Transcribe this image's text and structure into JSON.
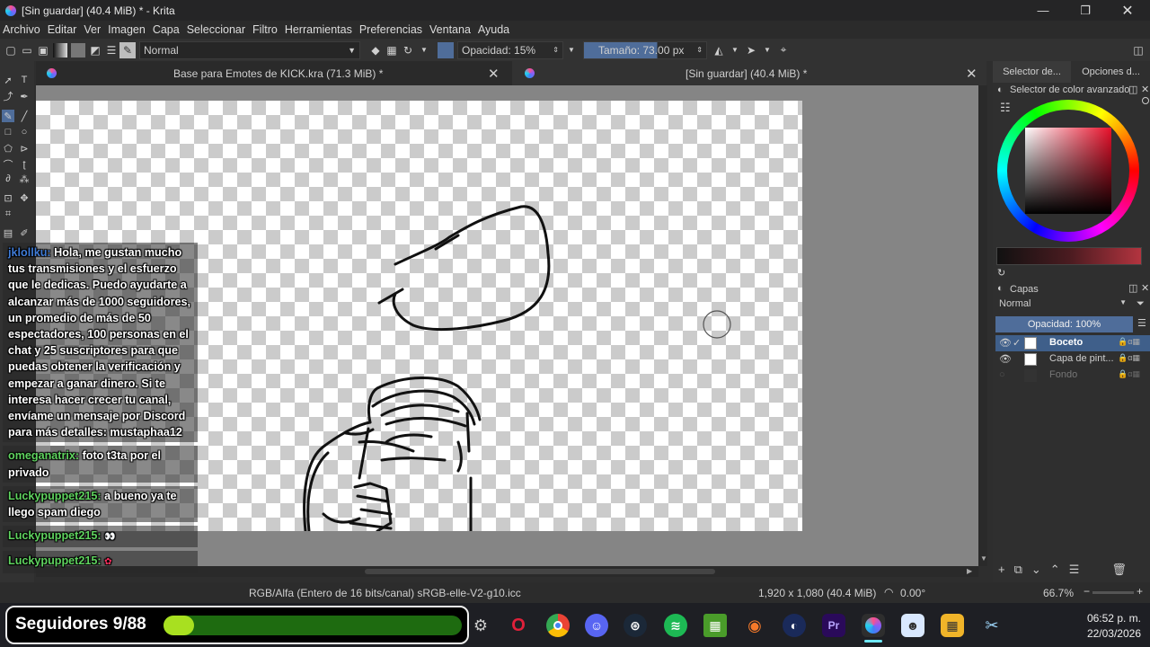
{
  "titlebar": {
    "title": "[Sin guardar]  (40.4 MiB) * - Krita"
  },
  "menu": [
    "Archivo",
    "Editar",
    "Ver",
    "Imagen",
    "Capa",
    "Seleccionar",
    "Filtro",
    "Herramientas",
    "Preferencias",
    "Ventana",
    "Ayuda"
  ],
  "toolbar": {
    "blend_mode": "Normal",
    "opacity": "Opacidad: 15%",
    "size": "Tamaño: 73.00 px"
  },
  "tabs": [
    {
      "label": "Base para Emotes de KICK.kra (71.3 MiB) *"
    },
    {
      "label": "[Sin guardar]  (40.4 MiB) *"
    }
  ],
  "docker": {
    "tab1": "Selector de...",
    "tab2": "Opciones d...",
    "color_title": "Selector de color avanzado",
    "layers_title": "Capas",
    "blend_mode": "Normal",
    "opacity": "Opacidad:  100%",
    "layers": [
      {
        "name": "Boceto",
        "active": true
      },
      {
        "name": "Capa de pint...",
        "active": false
      },
      {
        "name": "Fondo",
        "active": false
      }
    ]
  },
  "status": {
    "color_profile": "RGB/Alfa (Entero de 16 bits/canal)  sRGB-elle-V2-g10.icc",
    "dimensions": "1,920 x 1,080 (40.4 MiB)",
    "rotation": "0.00°",
    "zoom": "66.7%"
  },
  "chat": [
    {
      "user": "jklollku:",
      "text": "Hola, me gustan mucho tus transmisiones y el esfuerzo que le dedicas. Puedo ayudarte a alcanzar más de 1000 seguidores, un promedio de más de 50 espectadores, 100 personas en el chat y 25 suscriptores para que puedas obtener la verificación y empezar a ganar dinero. Si te interesa hacer crecer tu canal, envíame un mensaje por Discord para más detalles: mustaphaa12",
      "color": "#3f7bd6"
    },
    {
      "user": "omeganatrix:",
      "text": "foto t3ta por el privado",
      "color": "#5fd35f"
    },
    {
      "user": "Luckypuppet215:",
      "text": "a bueno ya te llego spam diego",
      "color": "#5fd35f"
    },
    {
      "user": "Luckypuppet215:",
      "text": "",
      "color": "#5fd35f"
    },
    {
      "user": "Luckypuppet215:",
      "text": "",
      "color": "#5fd35f"
    }
  ],
  "followers": {
    "label": "Seguidores 9/88",
    "progress": 0.102
  },
  "clock": {
    "time": "06:52 p. m.",
    "date": "22/03/2026"
  },
  "colors": {
    "accent_blue": "#4f6d9a",
    "progress_green": "#a8e020",
    "selected_layer": "#3f5f8a"
  }
}
